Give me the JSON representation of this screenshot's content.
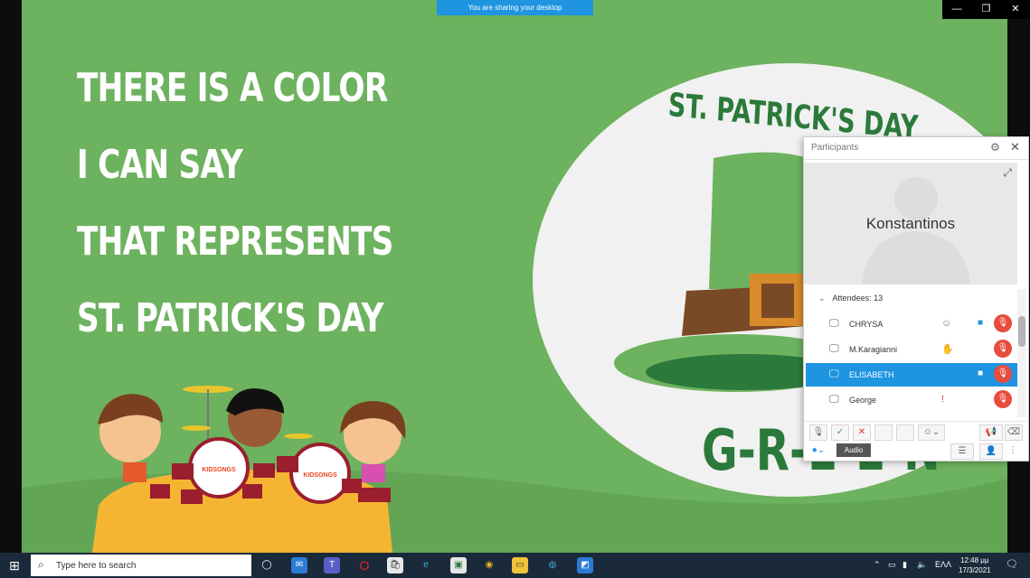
{
  "share_banner": "You are sharing your desktop",
  "window_controls": [
    "—",
    "❐",
    "✕"
  ],
  "slide": {
    "lyrics": [
      "THERE IS A COLOR",
      "I CAN SAY",
      "THAT REPRESENTS",
      "ST. PATRICK'S DAY"
    ],
    "hat_title": "ST. PATRICK'S DAY",
    "answer": "G-R-E-E-N",
    "drum_logo": "KIDSONGS",
    "colors": {
      "background": "#6db25f",
      "hat_green": "#2b7a3b",
      "circle": "#f1f1f1"
    }
  },
  "participants": {
    "title": "Participants",
    "video_name": "Konstantinos",
    "attendees_label": "Attendees: 13",
    "rows": [
      {
        "name": "CHRYSA"
      },
      {
        "name": "M.Karagianni"
      },
      {
        "name": "ELISABETH"
      },
      {
        "name": "George"
      }
    ],
    "tooltip": "Audio"
  },
  "taskbar": {
    "search_placeholder": "Type here to search",
    "clock_time": "12:48 μμ",
    "clock_date": "17/3/2021",
    "lang": "ΕΛΛ"
  }
}
